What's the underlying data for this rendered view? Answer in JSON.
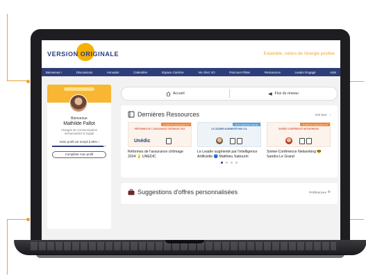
{
  "header": {
    "logo_left": "VERSION",
    "logo_right": "ORIGINALE",
    "tagline": "Ensemble, créons de l'énergie positive"
  },
  "nav": {
    "items": [
      "Bienvenue !",
      "Discussions",
      "Annuaire",
      "Calendrier",
      "Espace Carrière",
      "Vie chez VO",
      "Parcours Pilote",
      "Ressources",
      "Leader Engagé",
      "Aide"
    ]
  },
  "profile": {
    "welcome": "Bienvenue",
    "name": "Mathilde Fallot",
    "role_line1": "Chargée de Communication",
    "role_line2": "évènementiel et Digital",
    "progress_label": "Votre profil est rempli à 95% !",
    "progress_value": 0.95,
    "complete_button": "Compléter mon profil"
  },
  "tabs": [
    {
      "label": "Accueil",
      "icon": "home-icon"
    },
    {
      "label": "Flux du réseau",
      "icon": "megaphone-icon"
    }
  ],
  "resources": {
    "title": "Dernières Ressources",
    "see_all": "Voir tout",
    "items": [
      {
        "tag": "Conférence Apprenante VO",
        "thumb_title": "RÉFORMES DE L'ASSURANCE CHÔMAGE 2024",
        "brand": "Unédic",
        "caption": "Réformes de l'assurance chômage 2024 💡 UNEDIC"
      },
      {
        "tag": "Club Leadership Ultimate",
        "thumb_title": "LE LEADER AUGMENTÉ PAR L'IA",
        "caption": "Le Leader augmenté par l'intelligence Artificielle 🔵 Matthieu Sabourin"
      },
      {
        "tag": "Conférence Apprenante VO",
        "thumb_title": "SOIRÉE CONFÉRENCE NETWORKING",
        "caption": "Soirée-Conférence Networking 😎 Sandra Le Grand"
      }
    ],
    "pagination_active": 0,
    "pagination_count": 4
  },
  "offers": {
    "title": "Suggestions d'offres personnalisées",
    "preferences": "Préférences"
  },
  "colors": {
    "brand_navy": "#2e3e78",
    "accent_orange": "#f0a030",
    "logo_yellow": "#f5b100"
  }
}
